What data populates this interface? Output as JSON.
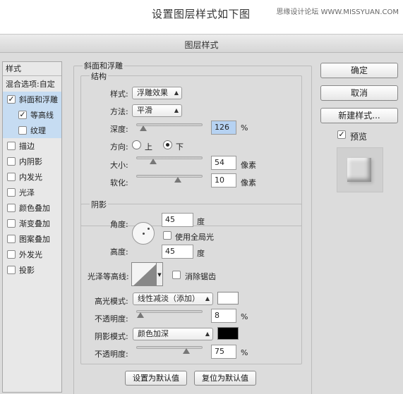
{
  "caption": {
    "title": "设置图层样式如下图",
    "site": "思缘设计论坛 WWW.MISSYUAN.COM"
  },
  "dialog": {
    "title": "图层样式"
  },
  "left_panel": {
    "header": "样式",
    "items": [
      {
        "label": "混合选项:自定",
        "checkbox": false,
        "checked": false,
        "selected": false,
        "indent": false
      },
      {
        "label": "斜面和浮雕",
        "checkbox": true,
        "checked": true,
        "selected": true,
        "indent": false
      },
      {
        "label": "等高线",
        "checkbox": true,
        "checked": true,
        "selected": true,
        "indent": true
      },
      {
        "label": "纹理",
        "checkbox": true,
        "checked": false,
        "selected": true,
        "indent": true
      },
      {
        "label": "描边",
        "checkbox": true,
        "checked": false,
        "selected": false,
        "indent": false
      },
      {
        "label": "内阴影",
        "checkbox": true,
        "checked": false,
        "selected": false,
        "indent": false
      },
      {
        "label": "内发光",
        "checkbox": true,
        "checked": false,
        "selected": false,
        "indent": false
      },
      {
        "label": "光泽",
        "checkbox": true,
        "checked": false,
        "selected": false,
        "indent": false
      },
      {
        "label": "颜色叠加",
        "checkbox": true,
        "checked": false,
        "selected": false,
        "indent": false
      },
      {
        "label": "渐变叠加",
        "checkbox": true,
        "checked": false,
        "selected": false,
        "indent": false
      },
      {
        "label": "图案叠加",
        "checkbox": true,
        "checked": false,
        "selected": false,
        "indent": false
      },
      {
        "label": "外发光",
        "checkbox": true,
        "checked": false,
        "selected": false,
        "indent": false
      },
      {
        "label": "投影",
        "checkbox": true,
        "checked": false,
        "selected": false,
        "indent": false
      }
    ]
  },
  "bevel": {
    "section_title": "斜面和浮雕",
    "structure_title": "结构",
    "style_label": "样式:",
    "style_value": "浮雕效果",
    "method_label": "方法:",
    "method_value": "平滑",
    "depth_label": "深度:",
    "depth_value": "126",
    "depth_unit": "%",
    "direction_label": "方向:",
    "direction_up": "上",
    "direction_down": "下",
    "direction_selected": "下",
    "size_label": "大小:",
    "size_value": "54",
    "size_unit": "像素",
    "soften_label": "软化:",
    "soften_value": "10",
    "soften_unit": "像素"
  },
  "shading": {
    "title": "阴影",
    "angle_label": "角度:",
    "angle_value": "45",
    "angle_unit": "度",
    "global_light_label": "使用全局光",
    "global_light_checked": false,
    "altitude_label": "高度:",
    "altitude_value": "45",
    "altitude_unit": "度",
    "gloss_contour_label": "光泽等高线:",
    "anti_alias_label": "消除锯齿",
    "anti_alias_checked": false,
    "highlight_mode_label": "高光模式:",
    "highlight_mode_value": "线性减淡（添加）",
    "highlight_color": "#ffffff",
    "highlight_opacity_label": "不透明度:",
    "highlight_opacity_value": "8",
    "highlight_opacity_unit": "%",
    "shadow_mode_label": "阴影模式:",
    "shadow_mode_value": "颜色加深",
    "shadow_color": "#000000",
    "shadow_opacity_label": "不透明度:",
    "shadow_opacity_value": "75",
    "shadow_opacity_unit": "%"
  },
  "bottom_buttons": {
    "make_default": "设置为默认值",
    "reset_default": "复位为默认值"
  },
  "right_panel": {
    "ok": "确定",
    "cancel": "取消",
    "new_style": "新建样式...",
    "preview_label": "预览",
    "preview_checked": true
  },
  "icons": [
    "checkmark-icon",
    "dropdown-arrow-icon",
    "angle-dial-icon",
    "contour-icon",
    "preview-thumbnail"
  ]
}
